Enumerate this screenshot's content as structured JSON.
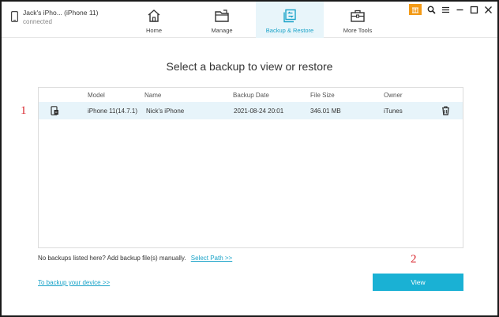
{
  "device": {
    "name": "Jack's iPho... (iPhone 11)",
    "status": "connected"
  },
  "nav": {
    "items": [
      {
        "label": "Home",
        "icon": "home-icon"
      },
      {
        "label": "Manage",
        "icon": "folder-icon"
      },
      {
        "label": "Backup & Restore",
        "icon": "backup-restore-icon",
        "active": true
      },
      {
        "label": "More Tools",
        "icon": "toolbox-icon"
      }
    ]
  },
  "window_controls": [
    "badge-icon",
    "search-icon",
    "menu-icon",
    "minimize-icon",
    "maximize-icon",
    "close-icon"
  ],
  "main": {
    "title": "Select a backup to view or restore",
    "table": {
      "headers": [
        "Model",
        "Name",
        "Backup Date",
        "File Size",
        "Owner"
      ],
      "rows": [
        {
          "model": "iPhone 11(14.7.1)",
          "name": "Nick's iPhone",
          "date": "2021-08-24 20:01",
          "size": "346.01 MB",
          "owner": "iTunes"
        }
      ]
    },
    "hint_text": "No backups listed here? Add backup file(s) manually.",
    "select_path_link": "Select Path >>",
    "backup_link": "To backup your device >>",
    "view_button": "View"
  },
  "annotations": {
    "marker_1": "1",
    "marker_2": "2"
  },
  "colors": {
    "accent": "#1ab1d4",
    "active_tab_bg": "#e8f5fa",
    "row_selected_bg": "#e7f4fa",
    "marker": "#d9272e",
    "badge": "#f39a16"
  }
}
